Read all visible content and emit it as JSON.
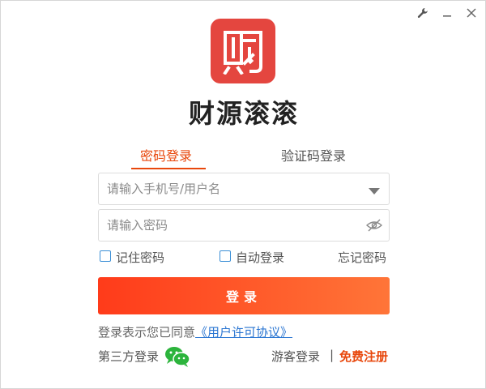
{
  "app": {
    "name": "财源滚滚"
  },
  "colors": {
    "accent": "#e8470c",
    "logo_bg": "#e4463f",
    "link": "#2b76d2"
  },
  "titlebar": {
    "icons": [
      "wrench-icon",
      "minimize-icon",
      "close-icon"
    ]
  },
  "tabs": {
    "password_login": "密码登录",
    "code_login": "验证码登录",
    "active": "password_login"
  },
  "form": {
    "account_placeholder": "请输入手机号/用户名",
    "password_placeholder": "请输入密码",
    "remember_password": "记住密码",
    "auto_login": "自动登录",
    "forgot_password": "忘记密码",
    "remember_checked": false,
    "auto_login_checked": false
  },
  "login_button": "登录",
  "agreement": {
    "prefix": "登录表示您已同意",
    "link": "《用户许可协议》"
  },
  "footer": {
    "third_party": "第三方登录",
    "guest_login": "游客登录",
    "separator": "|",
    "register": "免费注册"
  }
}
